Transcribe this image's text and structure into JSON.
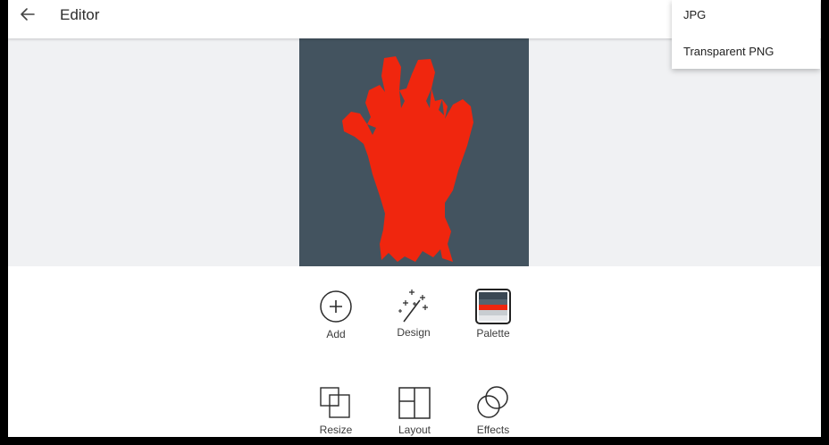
{
  "header": {
    "title": "Editor",
    "back_icon": "arrow-left-icon"
  },
  "export_menu": {
    "items": [
      "JPG",
      "Transparent PNG"
    ]
  },
  "artwork": {
    "background_color": "#43535f",
    "figure_color": "#f0260e",
    "subject": "zombie-hand"
  },
  "tools": {
    "row1": [
      {
        "label": "Add",
        "icon": "plus-circle-icon"
      },
      {
        "label": "Design",
        "icon": "magic-wand-icon"
      },
      {
        "label": "Palette",
        "icon": "palette-icon"
      }
    ],
    "row2": [
      {
        "label": "Resize",
        "icon": "resize-icon"
      },
      {
        "label": "Layout",
        "icon": "layout-icon"
      },
      {
        "label": "Effects",
        "icon": "effects-icon"
      }
    ]
  },
  "palette_colors": [
    "#3a4753",
    "#566570",
    "#f0260e",
    "#c8cdd1",
    "#e6e8ea"
  ],
  "colors": {
    "canvas_background": "#f0f1f3",
    "text": "#2c2c2c"
  }
}
